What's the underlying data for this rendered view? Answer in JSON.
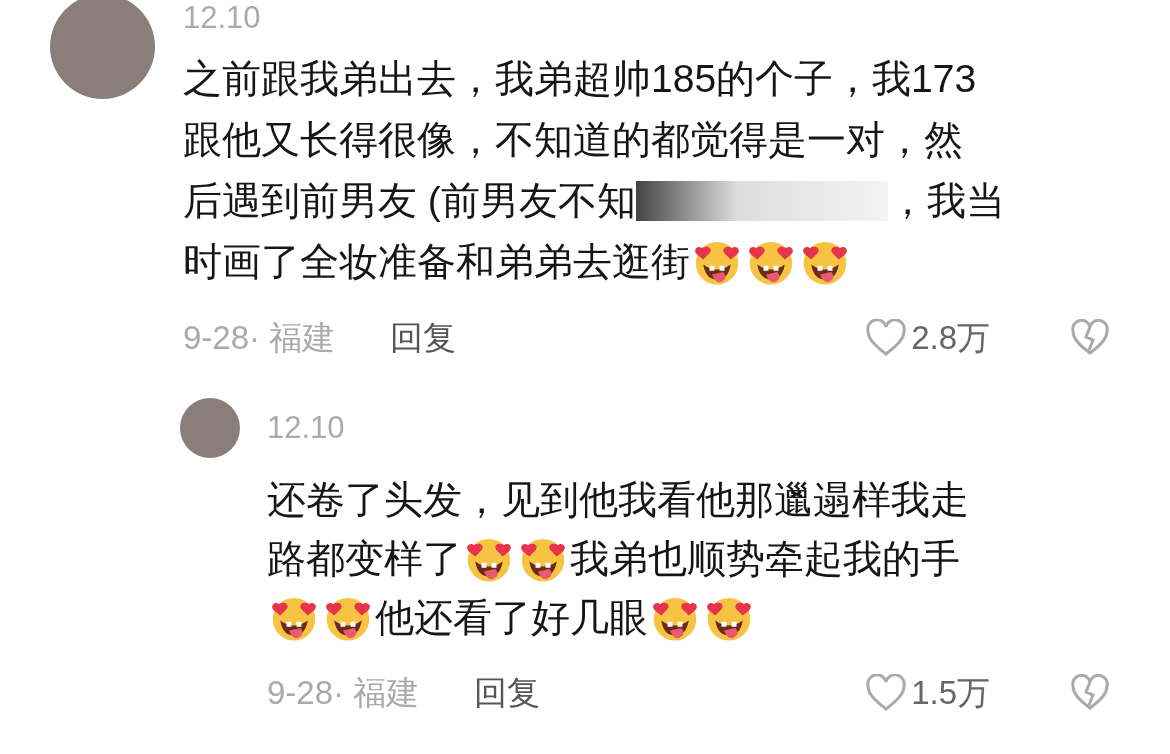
{
  "comments": [
    {
      "time": "12.10",
      "lines": [
        [
          {
            "kind": "text",
            "text": "之前跟我弟出去，我弟超帅185的个子，我173"
          }
        ],
        [
          {
            "kind": "text",
            "text": "跟他又长得很像，不知道的都觉得是一对，然"
          }
        ],
        [
          {
            "kind": "text",
            "text": "后遇到前男友 (前男友不知"
          },
          {
            "kind": "redacted"
          },
          {
            "kind": "text",
            "text": "，我当"
          }
        ],
        [
          {
            "kind": "text",
            "text": "时画了全妆准备和弟弟去逛街"
          },
          {
            "kind": "emoji"
          },
          {
            "kind": "emoji"
          },
          {
            "kind": "emoji"
          }
        ]
      ],
      "date_place": "9-28· 福建",
      "reply": "回复",
      "likes": "2.8万",
      "reply_level": false
    },
    {
      "time": "12.10",
      "lines": [
        [
          {
            "kind": "text",
            "text": "还卷了头发，见到他我看他那邋遢样我走"
          }
        ],
        [
          {
            "kind": "text",
            "text": "路都变样了"
          },
          {
            "kind": "emoji"
          },
          {
            "kind": "emoji"
          },
          {
            "kind": "text",
            "text": "我弟也顺势牵起我的手"
          }
        ],
        [
          {
            "kind": "emoji"
          },
          {
            "kind": "emoji"
          },
          {
            "kind": "text",
            "text": "他还看了好几眼"
          },
          {
            "kind": "emoji"
          },
          {
            "kind": "emoji"
          }
        ]
      ],
      "date_place": "9-28· 福建",
      "reply": "回复",
      "likes": "1.5万",
      "reply_level": true
    }
  ]
}
